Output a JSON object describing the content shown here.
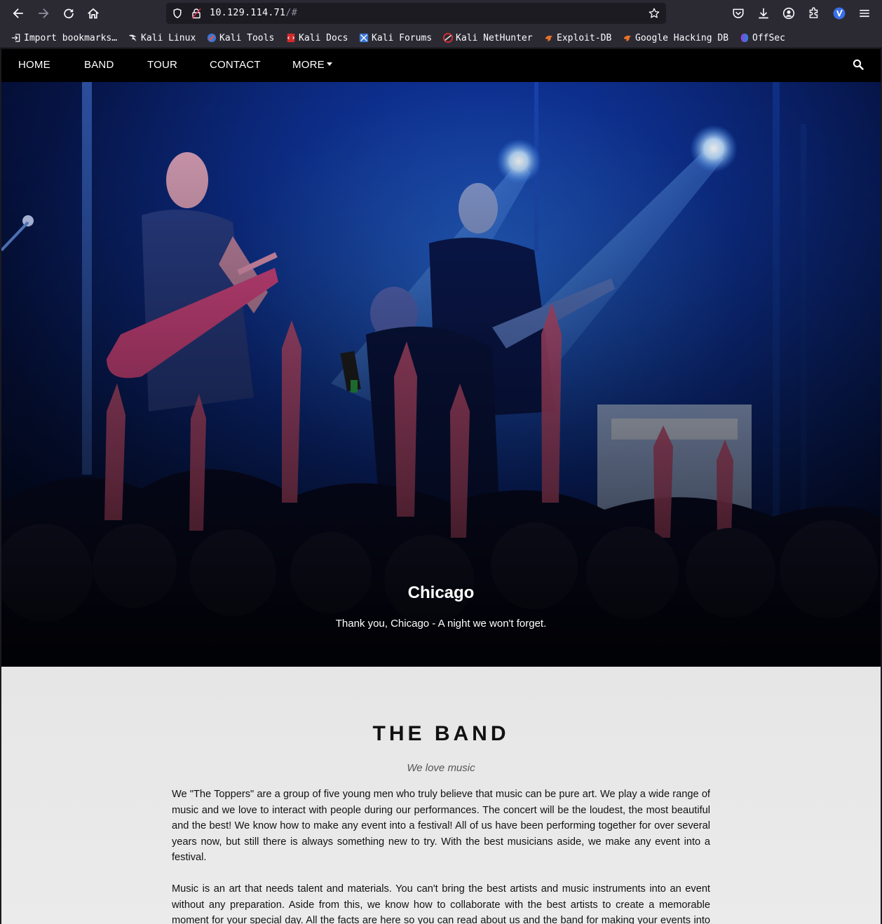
{
  "browser": {
    "url_host": "10.129.114.71",
    "url_path": "/#",
    "bookmarks": [
      {
        "label": "Import bookmarks…",
        "icon": "import-icon"
      },
      {
        "label": "Kali Linux",
        "icon": "kali-dragon-icon"
      },
      {
        "label": "Kali Tools",
        "icon": "kali-tools-icon"
      },
      {
        "label": "Kali Docs",
        "icon": "kali-docs-icon"
      },
      {
        "label": "Kali Forums",
        "icon": "kali-forums-icon"
      },
      {
        "label": "Kali NetHunter",
        "icon": "kali-nethunter-icon"
      },
      {
        "label": "Exploit-DB",
        "icon": "exploit-db-icon"
      },
      {
        "label": "Google Hacking DB",
        "icon": "ghdb-icon"
      },
      {
        "label": "OffSec",
        "icon": "offsec-icon"
      }
    ]
  },
  "nav": {
    "items": [
      "HOME",
      "BAND",
      "TOUR",
      "CONTACT",
      "MORE"
    ],
    "search_icon": "search-icon"
  },
  "hero": {
    "title": "Chicago",
    "text": "Thank you, Chicago - A night we won't forget."
  },
  "band": {
    "title": "THE BAND",
    "subtitle": "We love music",
    "paragraphs": [
      "We \"The Toppers\" are a group of five young men who truly believe that music can be pure art. We play a wide range of music and we love to interact with people during our performances. The concert will be the loudest, the most beautiful and the best! We know how to make any event into a festival! All of us have been performing together for over several years now, but still there is always something new to try. With the best musicians aside, we make any event into a festival.",
      "Music is an art that needs talent and materials. You can't bring the best artists and music instruments into an event without any preparation. Aside from this, we know how to collaborate with the best artists to create a memorable moment for your special day. All the facts are here so you can read about us and the band for making your events into a"
    ]
  },
  "colors": {
    "nav_bg": "#000000",
    "browser_chrome": "#2b2a33",
    "url_field": "#1c1b22",
    "hero_blue": "#1f5fe0",
    "section_bg": "#e9e9e9"
  }
}
